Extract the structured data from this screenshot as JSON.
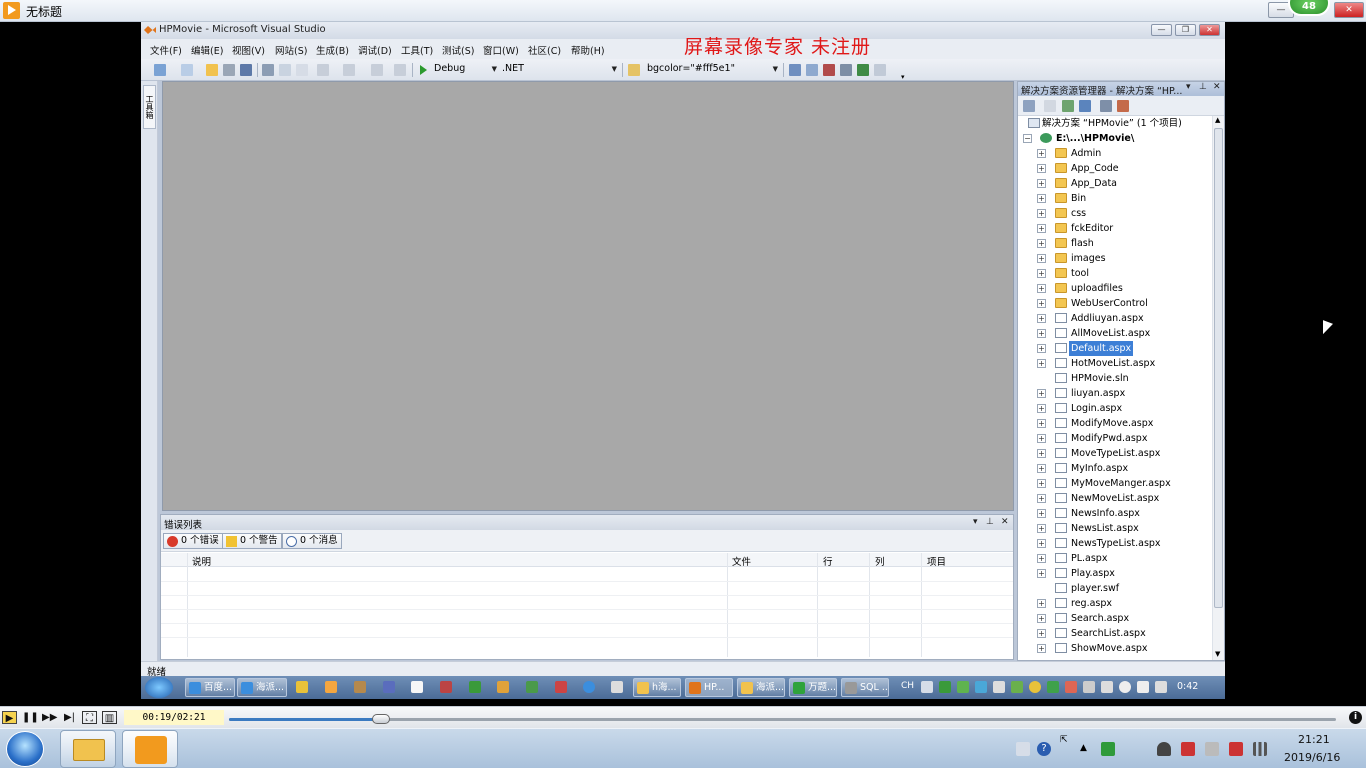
{
  "player": {
    "title": "无标题",
    "badge": "48",
    "timecode": "00:19/02:21",
    "progress_fraction": 0.137
  },
  "vs": {
    "title": "HPMovie - Microsoft Visual Studio",
    "watermark": "屏幕录像专家  未注册",
    "menu": [
      "文件(F)",
      "编辑(E)",
      "视图(V)",
      "网站(S)",
      "生成(B)",
      "调试(D)",
      "工具(T)",
      "测试(S)",
      "窗口(W)",
      "社区(C)",
      "帮助(H)"
    ],
    "toolbar": {
      "config": "Debug",
      "platform": ".NET",
      "find": "bgcolor=\"#fff5e1\""
    },
    "toolbox_tab": "工具箱",
    "status": "就绪"
  },
  "error_list": {
    "title": "错误列表",
    "errors_btn": "0 个错误",
    "warnings_btn": "0 个警告",
    "messages_btn": "0 个消息",
    "columns": [
      "说明",
      "文件",
      "行",
      "列",
      "项目"
    ]
  },
  "solution_explorer": {
    "title": "解决方案资源管理器 - 解决方案 “HP...",
    "solution_label": "解决方案 “HPMovie” (1 个项目)",
    "project": "E:\\...\\HPMovie\\",
    "items": [
      {
        "name": "Admin",
        "type": "folder"
      },
      {
        "name": "App_Code",
        "type": "folder"
      },
      {
        "name": "App_Data",
        "type": "folder"
      },
      {
        "name": "Bin",
        "type": "folder"
      },
      {
        "name": "css",
        "type": "folder"
      },
      {
        "name": "fckEditor",
        "type": "folder"
      },
      {
        "name": "flash",
        "type": "folder"
      },
      {
        "name": "images",
        "type": "folder"
      },
      {
        "name": "tool",
        "type": "folder"
      },
      {
        "name": "uploadfiles",
        "type": "folder"
      },
      {
        "name": "WebUserControl",
        "type": "folder"
      },
      {
        "name": "Addliuyan.aspx",
        "type": "file"
      },
      {
        "name": "AllMoveList.aspx",
        "type": "file"
      },
      {
        "name": "Default.aspx",
        "type": "file",
        "selected": true
      },
      {
        "name": "HotMoveList.aspx",
        "type": "file"
      },
      {
        "name": "HPMovie.sln",
        "type": "file",
        "leaf": true
      },
      {
        "name": "liuyan.aspx",
        "type": "file"
      },
      {
        "name": "Login.aspx",
        "type": "file"
      },
      {
        "name": "ModifyMove.aspx",
        "type": "file"
      },
      {
        "name": "ModifyPwd.aspx",
        "type": "file"
      },
      {
        "name": "MoveTypeList.aspx",
        "type": "file"
      },
      {
        "name": "MyInfo.aspx",
        "type": "file"
      },
      {
        "name": "MyMoveManger.aspx",
        "type": "file"
      },
      {
        "name": "NewMoveList.aspx",
        "type": "file"
      },
      {
        "name": "NewsInfo.aspx",
        "type": "file"
      },
      {
        "name": "NewsList.aspx",
        "type": "file"
      },
      {
        "name": "NewsTypeList.aspx",
        "type": "file"
      },
      {
        "name": "PL.aspx",
        "type": "file"
      },
      {
        "name": "Play.aspx",
        "type": "file"
      },
      {
        "name": "player.swf",
        "type": "file",
        "leaf": true
      },
      {
        "name": "reg.aspx",
        "type": "file"
      },
      {
        "name": "Search.aspx",
        "type": "file"
      },
      {
        "name": "SearchList.aspx",
        "type": "file"
      },
      {
        "name": "ShowMove.aspx",
        "type": "file"
      }
    ]
  },
  "inner_taskbar": {
    "buttons": [
      "百度...",
      "海派...",
      "h海...",
      "HP...",
      "海派...",
      "万题...",
      "SQL ..."
    ],
    "lang": "CH",
    "clock": "0:42"
  },
  "taskbar": {
    "time": "21:21",
    "date": "2019/6/16"
  }
}
